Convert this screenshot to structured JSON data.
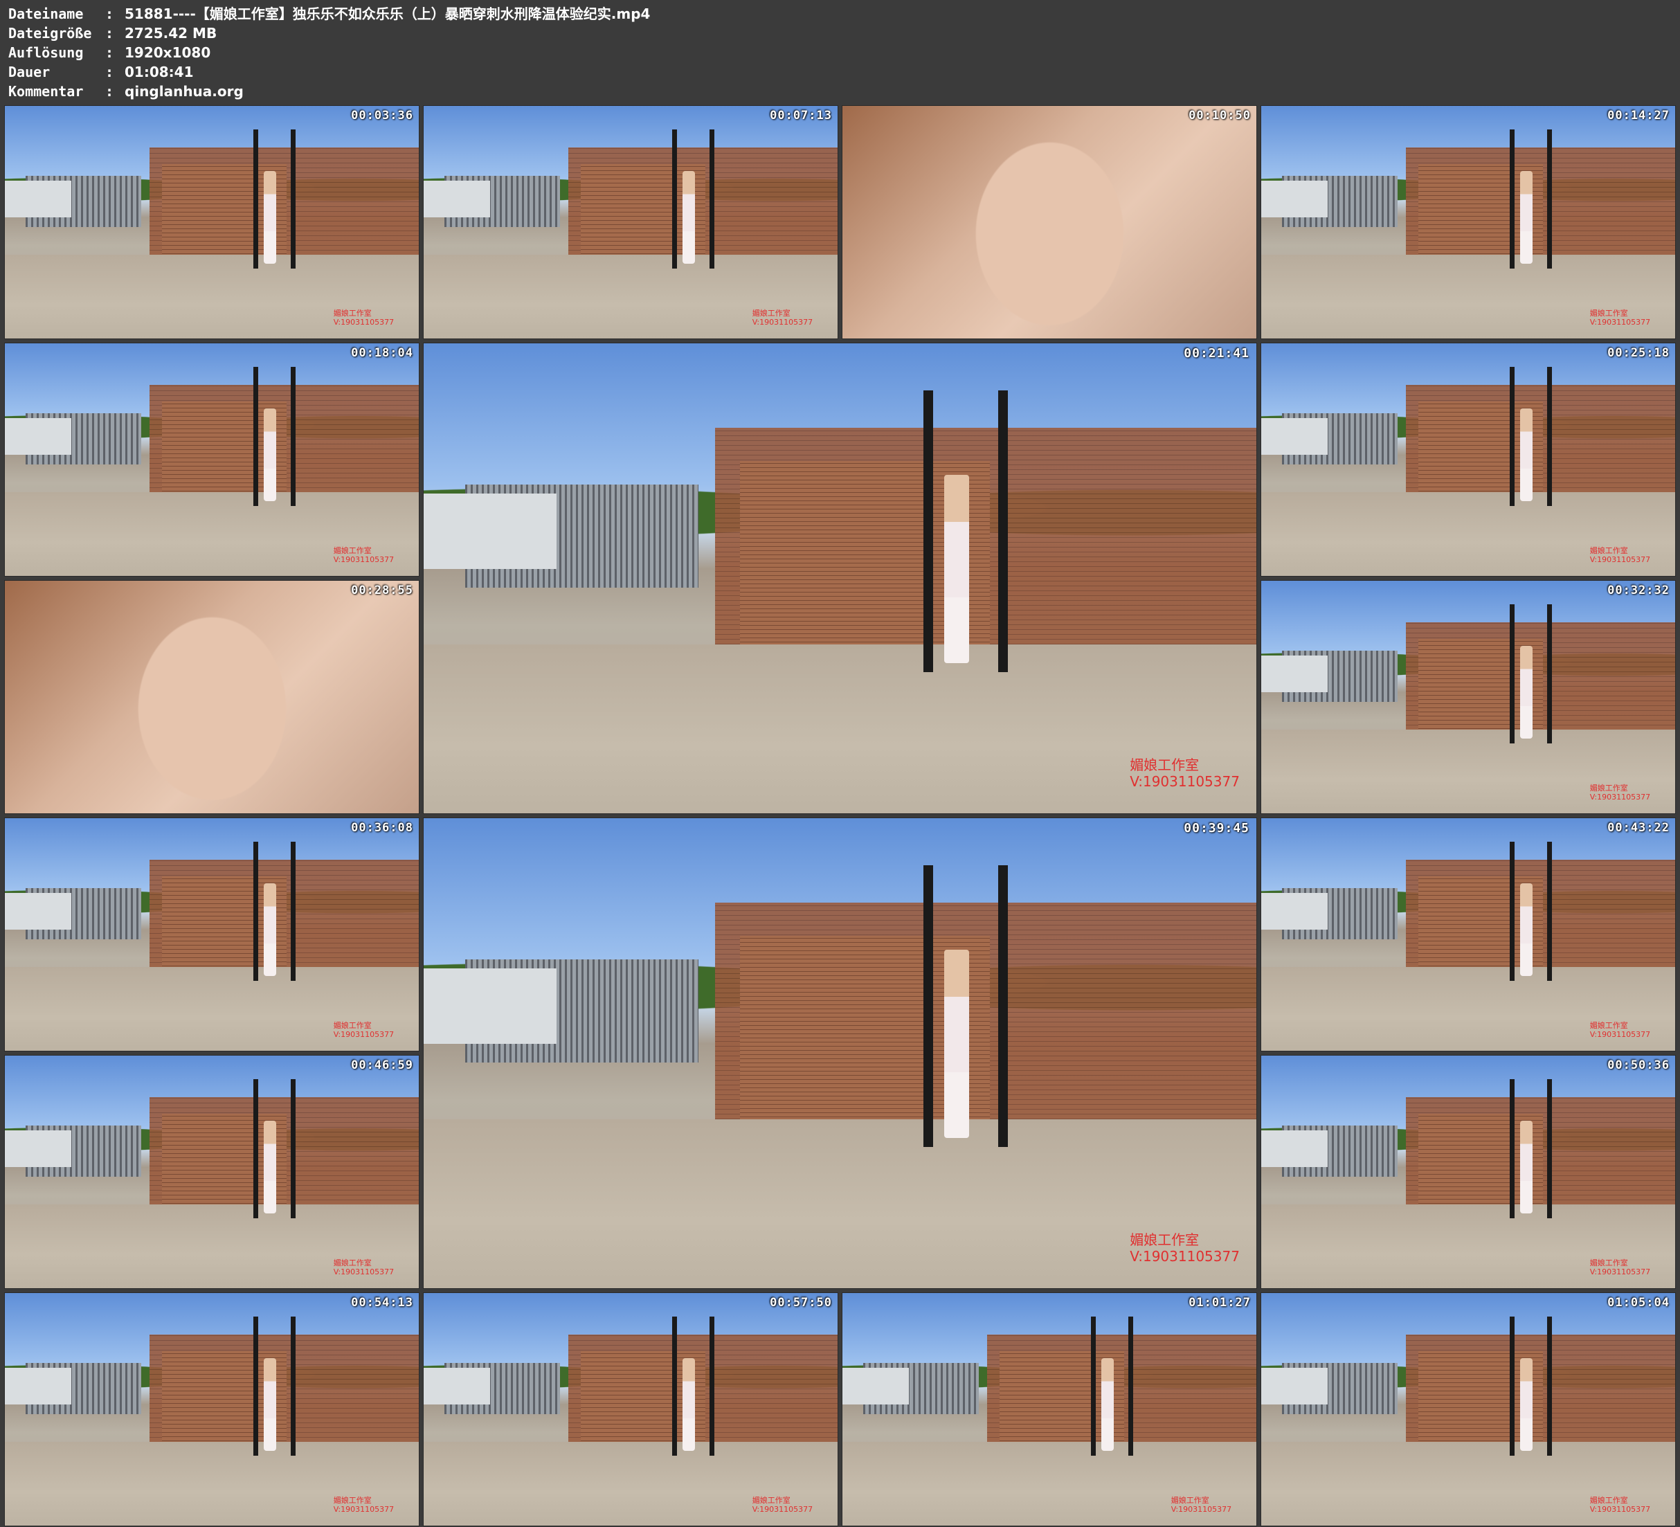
{
  "header": {
    "rows": [
      {
        "key": "Dateiname",
        "sep": ":",
        "value": "51881----【媚娘工作室】独乐乐不如众乐乐（上）暴晒穿刺水刑降温体验纪实.mp4"
      },
      {
        "key": "Dateigröße",
        "sep": ":",
        "value": "2725.42 MB"
      },
      {
        "key": "Auflösung",
        "sep": ":",
        "value": "1920x1080"
      },
      {
        "key": "Dauer",
        "sep": ":",
        "value": "01:08:41"
      },
      {
        "key": "Kommentar",
        "sep": ":",
        "value": "qinglanhua.org"
      }
    ]
  },
  "thumbnails": [
    {
      "time": "00:03:36",
      "kind": "scene"
    },
    {
      "time": "00:07:13",
      "kind": "scene"
    },
    {
      "time": "00:10:50",
      "kind": "close"
    },
    {
      "time": "00:14:27",
      "kind": "scene"
    },
    {
      "time": "00:18:04",
      "kind": "scene"
    },
    {
      "time": "00:21:41",
      "kind": "large"
    },
    {
      "time": "00:25:18",
      "kind": "scene"
    },
    {
      "time": "00:28:55",
      "kind": "close"
    },
    {
      "time": "00:32:32",
      "kind": "scene"
    },
    {
      "time": "00:36:08",
      "kind": "scene"
    },
    {
      "time": "00:39:45",
      "kind": "large"
    },
    {
      "time": "00:43:22",
      "kind": "scene"
    },
    {
      "time": "00:46:59",
      "kind": "scene"
    },
    {
      "time": "00:50:36",
      "kind": "scene"
    },
    {
      "time": "00:54:13",
      "kind": "scene"
    },
    {
      "time": "00:57:50",
      "kind": "scene"
    },
    {
      "time": "01:01:27",
      "kind": "scene"
    },
    {
      "time": "01:05:04",
      "kind": "scene"
    }
  ],
  "watermark": {
    "line1": "媚娘工作室",
    "line2": "V:19031105377"
  }
}
